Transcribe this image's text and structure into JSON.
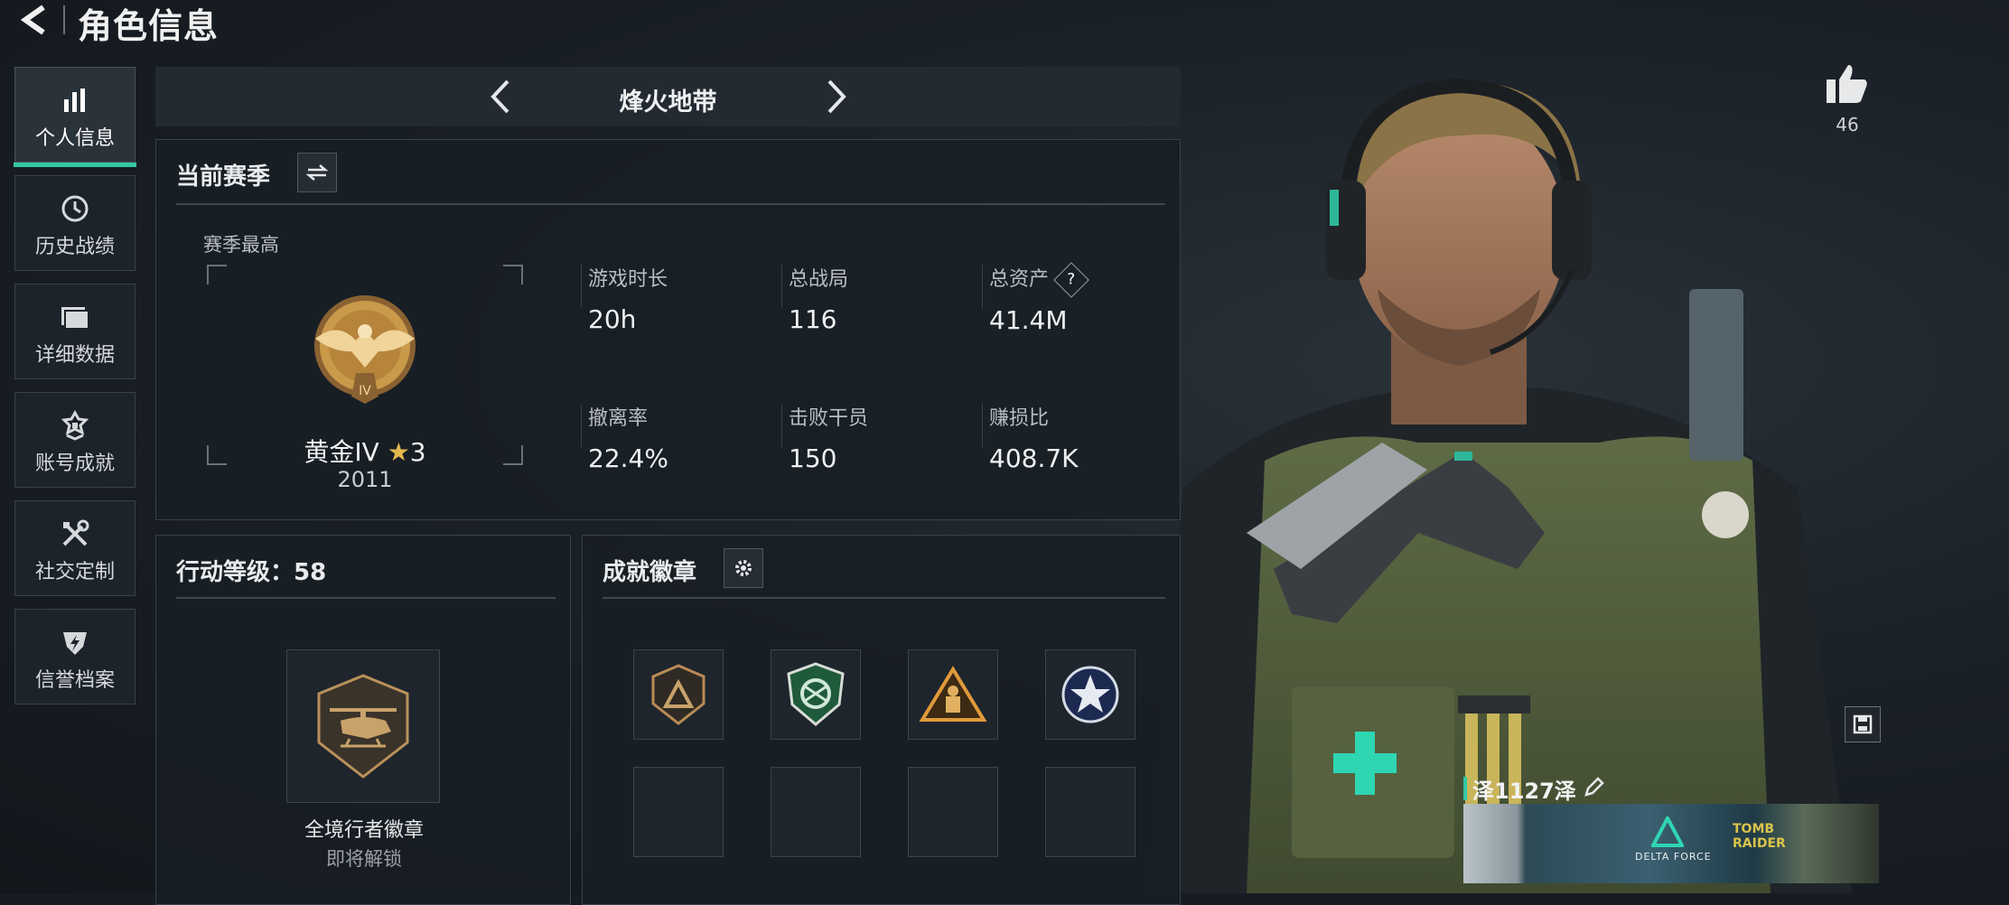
{
  "header": {
    "title": "角色信息"
  },
  "nav": {
    "items": [
      {
        "label": "个人信息",
        "icon": "bar-chart-icon",
        "active": true
      },
      {
        "label": "历史战绩",
        "icon": "history-clock-icon",
        "active": false
      },
      {
        "label": "详细数据",
        "icon": "folder-icon",
        "active": false
      },
      {
        "label": "账号成就",
        "icon": "achievement-icon",
        "active": false
      },
      {
        "label": "社交定制",
        "icon": "tools-icon",
        "active": false
      },
      {
        "label": "信誉档案",
        "icon": "shield-bolt-icon",
        "active": false
      }
    ]
  },
  "mode": {
    "title": "烽火地带"
  },
  "season": {
    "heading": "当前赛季",
    "best_label": "赛季最高",
    "rank_name": "黄金IV",
    "rank_stars": "3",
    "rank_score": "2011",
    "rank_badge_text": "IV",
    "stats": [
      {
        "label": "游戏时长",
        "value": "20h"
      },
      {
        "label": "总战局",
        "value": "116"
      },
      {
        "label": "总资产",
        "value": "41.4M",
        "help": "?"
      },
      {
        "label": "撤离率",
        "value": "22.4%"
      },
      {
        "label": "击败干员",
        "value": "150"
      },
      {
        "label": "赚损比",
        "value": "408.7K"
      }
    ]
  },
  "action_level": {
    "heading": "行动等级：58",
    "badge_name": "全境行者徽章",
    "badge_status": "即将解锁"
  },
  "achievements": {
    "heading": "成就徽章"
  },
  "profile": {
    "likes": "46",
    "player_name": "泽1127泽",
    "banner_logo_text": "DELTA FORCE",
    "banner_tomb_text": "TOMB RAIDER"
  },
  "colors": {
    "accent": "#33c7a5",
    "gold": "#c99a4a",
    "panel_border": "#39414a"
  }
}
